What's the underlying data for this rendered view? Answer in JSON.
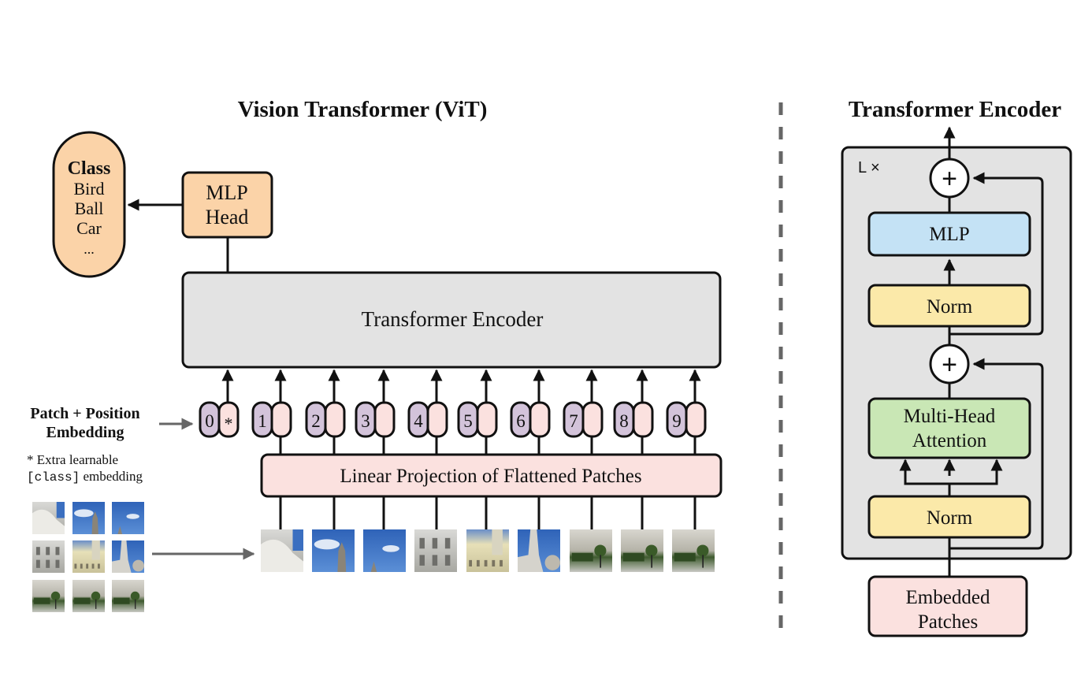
{
  "colors": {
    "orange": "#fbd3a8",
    "gray_block": "#e3e3e3",
    "pink": "#fbe1df",
    "purple": "#d3c3da",
    "blue": "#c4e2f5",
    "yellow": "#fbe9a9",
    "green": "#c9e7b5",
    "divider": "#666666"
  },
  "vit": {
    "title": "Vision Transformer (ViT)",
    "class_box": {
      "heading": "Class",
      "items": [
        "Bird",
        "Ball",
        "Car",
        "..."
      ]
    },
    "mlp_head": {
      "line1": "MLP",
      "line2": "Head"
    },
    "transformer_encoder": "Transformer Encoder",
    "embedding_label": {
      "line1": "Patch + Position",
      "line2": "Embedding"
    },
    "footnote": {
      "line1": "* Extra learnable",
      "code": "[class]",
      "line2_rest": " embedding"
    },
    "tokens": [
      {
        "position": "0",
        "content": "*"
      },
      {
        "position": "1",
        "content": ""
      },
      {
        "position": "2",
        "content": ""
      },
      {
        "position": "3",
        "content": ""
      },
      {
        "position": "4",
        "content": ""
      },
      {
        "position": "5",
        "content": ""
      },
      {
        "position": "6",
        "content": ""
      },
      {
        "position": "7",
        "content": ""
      },
      {
        "position": "8",
        "content": ""
      },
      {
        "position": "9",
        "content": ""
      }
    ],
    "linear_projection": "Linear Projection of Flattened Patches",
    "patch_count": 9,
    "grid": {
      "rows": 3,
      "cols": 3
    }
  },
  "encoder_detail": {
    "title": "Transformer Encoder",
    "repeat_label": "L ×",
    "mlp": "MLP",
    "norm_top": "Norm",
    "attention": {
      "line1": "Multi-Head",
      "line2": "Attention"
    },
    "norm_bottom": "Norm",
    "embedded_patches": {
      "line1": "Embedded",
      "line2": "Patches"
    },
    "plus_symbol": "+"
  }
}
